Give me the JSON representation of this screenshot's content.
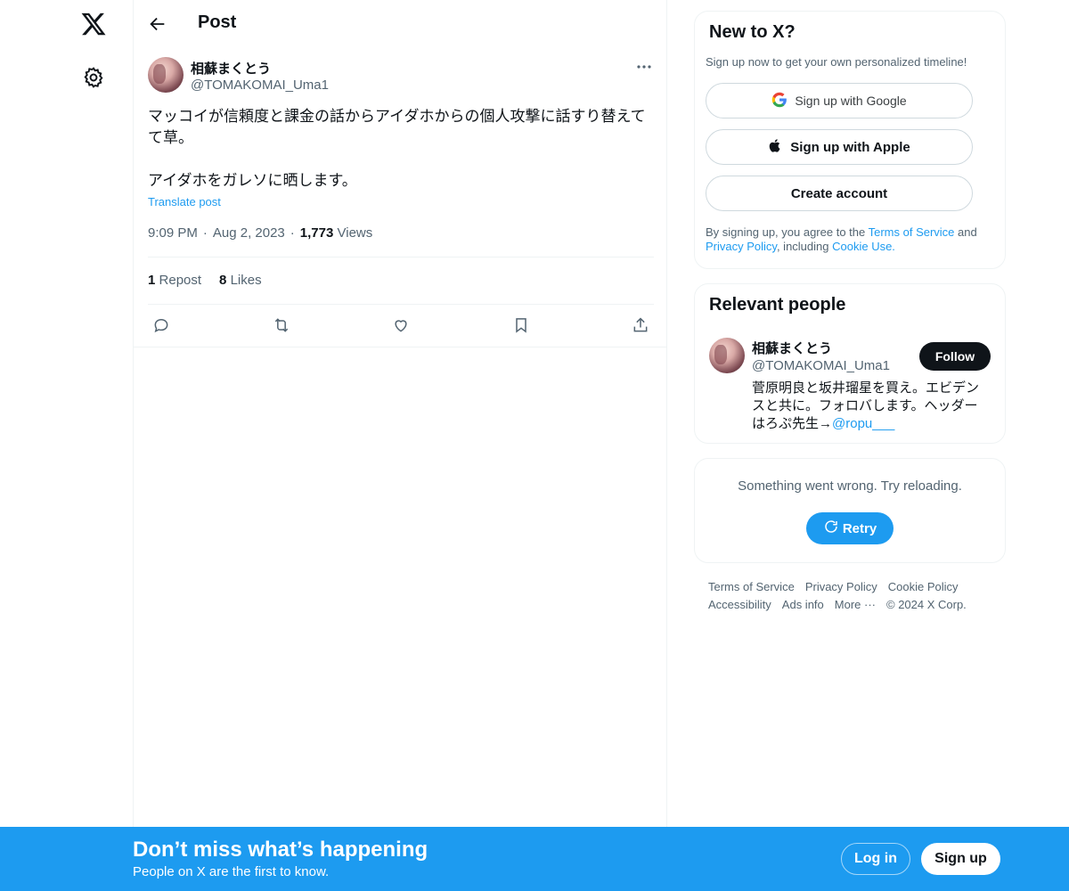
{
  "nav": {
    "logo_icon": "x-logo-icon",
    "settings_icon": "gear-icon"
  },
  "header": {
    "title": "Post",
    "back_icon": "arrow-left-icon"
  },
  "post": {
    "author_name": "相蘇まくとう",
    "author_handle": "@TOMAKOMAI_Uma1",
    "text": "マッコイが信頼度と課金の話からアイダホからの個人攻撃に話すり替えてて草。\n\nアイダホをガレソに晒します。",
    "translate": "Translate post",
    "time": "9:09 PM",
    "sep": "·",
    "date": "Aug 2, 2023",
    "views_count": "1,773",
    "views_label": "Views",
    "reposts_count": "1",
    "reposts_label": "Repost",
    "likes_count": "8",
    "likes_label": "Likes"
  },
  "new_to_x": {
    "title": "New to X?",
    "subtitle": "Sign up now to get your own personalized timeline!",
    "google_label": "Sign up with Google",
    "apple_label": "Sign up with Apple",
    "create_label": "Create account",
    "legal_1": "By signing up, you agree to the ",
    "terms": "Terms of Service",
    "legal_2": " and ",
    "privacy": "Privacy Policy",
    "legal_3": ", including ",
    "cookie": "Cookie Use."
  },
  "relevant": {
    "title": "Relevant people",
    "name": "相蘇まくとう",
    "handle": "@TOMAKOMAI_Uma1",
    "follow": "Follow",
    "bio": "菅原明良と坂井瑠星を買え。エビデンスと共に。フォロバします。ヘッダーはろぷ先生→",
    "bio_link": "@ropu___"
  },
  "error_card": {
    "message": "Something went wrong. Try reloading.",
    "retry": "Retry"
  },
  "footer": {
    "links": [
      "Terms of Service",
      "Privacy Policy",
      "Cookie Policy",
      "Accessibility",
      "Ads info",
      "More ···",
      "© 2024 X Corp."
    ]
  },
  "banner": {
    "title": "Don’t miss what’s happening",
    "subtitle": "People on X are the first to know.",
    "login": "Log in",
    "signup": "Sign up"
  },
  "colors": {
    "accent": "#1d9bf0",
    "text": "#0f1419",
    "muted": "#536471"
  }
}
